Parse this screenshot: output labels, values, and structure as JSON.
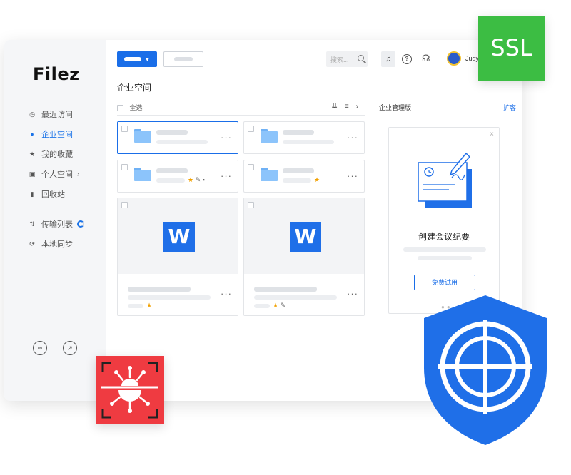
{
  "app": {
    "logo": "Filez"
  },
  "sidebar": {
    "items": [
      {
        "label": "最近访问",
        "icon": "clock-icon",
        "active": false
      },
      {
        "label": "企业空间",
        "icon": "enterprise-icon",
        "active": true
      },
      {
        "label": "我的收藏",
        "icon": "star-icon",
        "active": false
      },
      {
        "label": "个人空间",
        "icon": "person-folder-icon",
        "active": false
      },
      {
        "label": "回收站",
        "icon": "trash-icon",
        "active": false
      }
    ],
    "items2": [
      {
        "label": "传输列表",
        "icon": "transfer-icon"
      },
      {
        "label": "本地同步",
        "icon": "sync-icon"
      }
    ]
  },
  "header": {
    "search_placeholder": "搜索...",
    "user_name": "Judy"
  },
  "main": {
    "title": "企业空间",
    "select_all": "全选"
  },
  "right_panel": {
    "title": "企业管理版",
    "link": "扩容",
    "promo_title": "创建会议纪要",
    "promo_button": "免费试用"
  },
  "colors": {
    "accent": "#1a6ee8",
    "ssl": "#3cbd43",
    "virus": "#ef3b41",
    "shield": "#1f6fe8"
  },
  "badges": {
    "ssl": "SSL"
  }
}
